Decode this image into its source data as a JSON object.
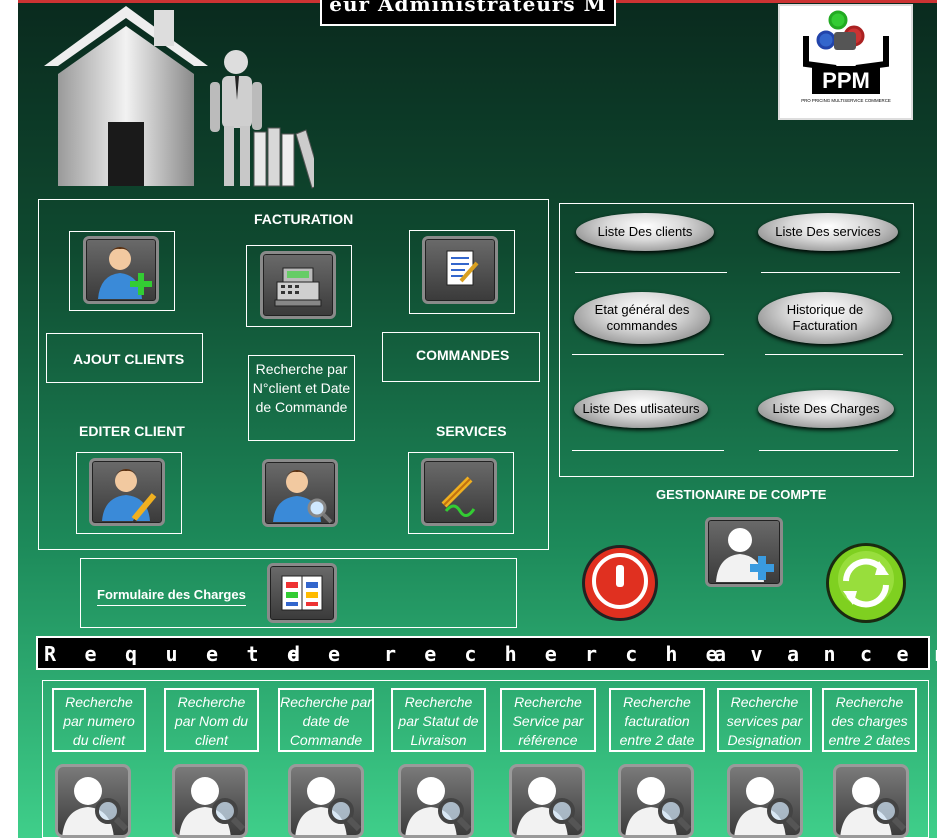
{
  "header": {
    "title_fragment": "eur Administrateurs M"
  },
  "logo": {
    "text": "PPM",
    "subtitle": "PRO PRICING MULTISERVICE COMMERCE"
  },
  "left_panel": {
    "facturation_label": "FACTURATION",
    "ajout_clients_label": "AJOUT CLIENTS",
    "commandes_label": "COMMANDES",
    "recherche_label": "Recherche par N°client et Date de Commande",
    "editer_client_label": "EDITER CLIENT",
    "services_label": "SERVICES"
  },
  "right_panel": {
    "buttons": [
      {
        "label": "Liste Des clients"
      },
      {
        "label": "Liste Des services"
      },
      {
        "label": "Etat général des commandes"
      },
      {
        "label": "Historique de Facturation"
      },
      {
        "label": "Liste Des utlisateurs"
      },
      {
        "label": "Liste Des Charges"
      }
    ]
  },
  "account": {
    "label": "GESTIONAIRE DE COMPTE"
  },
  "charges": {
    "label": "Formulaire des Charges"
  },
  "search_bar": {
    "letters": [
      "R",
      "e",
      "q",
      "u",
      "e",
      "t",
      "e",
      "d",
      "e",
      "r",
      "e",
      "c",
      "h",
      "e",
      "r",
      "c",
      "h",
      "e",
      "a",
      "v",
      "a",
      "n",
      "c",
      "e",
      "r"
    ]
  },
  "search_buttons": [
    {
      "label": "Recherche par numero du client"
    },
    {
      "label": "Recherche par Nom du client"
    },
    {
      "label": "Recherche par date de Commande"
    },
    {
      "label": "Recherche par Statut de Livraison"
    },
    {
      "label": "Recherche Service par référence"
    },
    {
      "label": "Recherche facturation entre 2 date"
    },
    {
      "label": "Recherche services par Designation"
    },
    {
      "label": "Recherche des charges entre 2 dates"
    }
  ],
  "colors": {
    "power": "#e03020",
    "refresh": "#7fd020",
    "accent_green": "#3fcf8a"
  }
}
